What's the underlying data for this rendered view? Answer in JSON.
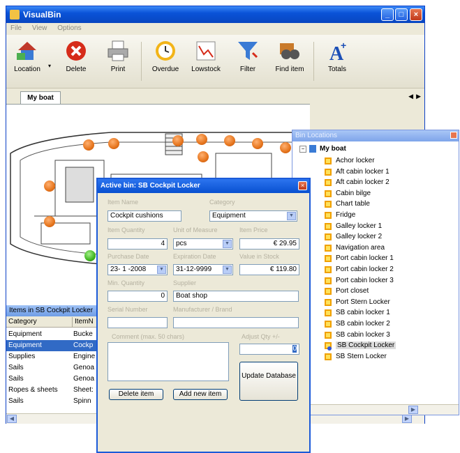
{
  "app": {
    "title": "VisualBin"
  },
  "menu": [
    "File",
    "View",
    "Options"
  ],
  "toolbar": [
    {
      "label": "Location",
      "icon": "house-icon"
    },
    {
      "label": "Delete",
      "icon": "delete-icon"
    },
    {
      "label": "Print",
      "icon": "printer-icon"
    },
    {
      "label": "Overdue",
      "icon": "clock-icon"
    },
    {
      "label": "Lowstock",
      "icon": "chart-icon"
    },
    {
      "label": "Filter",
      "icon": "funnel-icon"
    },
    {
      "label": "Find item",
      "icon": "binoculars-icon"
    },
    {
      "label": "Totals",
      "icon": "font-plus-icon"
    }
  ],
  "tab": {
    "label": "My boat"
  },
  "items_panel": {
    "title": "Items in SB Cockpit Locker",
    "columns": [
      "Category",
      "ItemN"
    ],
    "rows": [
      {
        "category": "Equipment",
        "item": "Bucke"
      },
      {
        "category": "Equipment",
        "item": "Cockp",
        "selected": true
      },
      {
        "category": "Supplies",
        "item": "Engine"
      },
      {
        "category": "Sails",
        "item": "Genoa"
      },
      {
        "category": "Sails",
        "item": "Genoa"
      },
      {
        "category": "Ropes & sheets",
        "item": "Sheet:"
      },
      {
        "category": "Sails",
        "item": "Spinn"
      }
    ]
  },
  "locations": {
    "title": "Bin Locations",
    "root": "My boat",
    "items": [
      "Achor locker",
      "Aft cabin locker 1",
      "Aft cabin locker 2",
      "Cabin bilge",
      "Chart table",
      "Fridge",
      "Galley locker 1",
      "Galley locker 2",
      "Navigation area",
      "Port cabin locker 1",
      "Port cabin locker 2",
      "Port cabin locker 3",
      "Port closet",
      "Port Stern Locker",
      "SB cabin locker 1",
      "SB cabin locker 2",
      "SB cabin locker 3",
      "SB Cockpit Locker",
      "SB Stern Locker"
    ],
    "selected": "SB Cockpit Locker"
  },
  "dialog": {
    "title": "Active bin: SB Cockpit Locker",
    "labels": {
      "item_name": "Item Name",
      "category": "Category",
      "item_quantity": "Item Quantity",
      "unit": "Unit of Measure",
      "item_price": "Item Price",
      "purchase_date": "Purchase Date",
      "expiration_date": "Expiration Date",
      "value_in_stock": "Value in Stock",
      "min_quantity": "Min. Quantity",
      "supplier": "Supplier",
      "serial_number": "Serial Number",
      "manufacturer": "Manufacturer / Brand",
      "comment": "Comment (max. 50 chars)",
      "adjust_qty": "Adjust Qty +/-"
    },
    "values": {
      "item_name": "Cockpit cushions",
      "category": "Equipment",
      "item_quantity": "4",
      "unit": "pcs",
      "item_price": "€ 29.95",
      "purchase_date": "23- 1 -2008",
      "expiration_date": "31-12-9999",
      "value_in_stock": "€ 119.80",
      "min_quantity": "0",
      "supplier": "Boat shop",
      "serial_number": "",
      "manufacturer": "",
      "comment": "",
      "adjust_qty": "0"
    },
    "buttons": {
      "delete": "Delete item",
      "add": "Add new item",
      "update": "Update Database"
    }
  },
  "colors": {
    "pin": "#e5741c",
    "selection": "#316ac5",
    "titlebar": "#0a53d8",
    "bin_box": "#ffe15a"
  }
}
